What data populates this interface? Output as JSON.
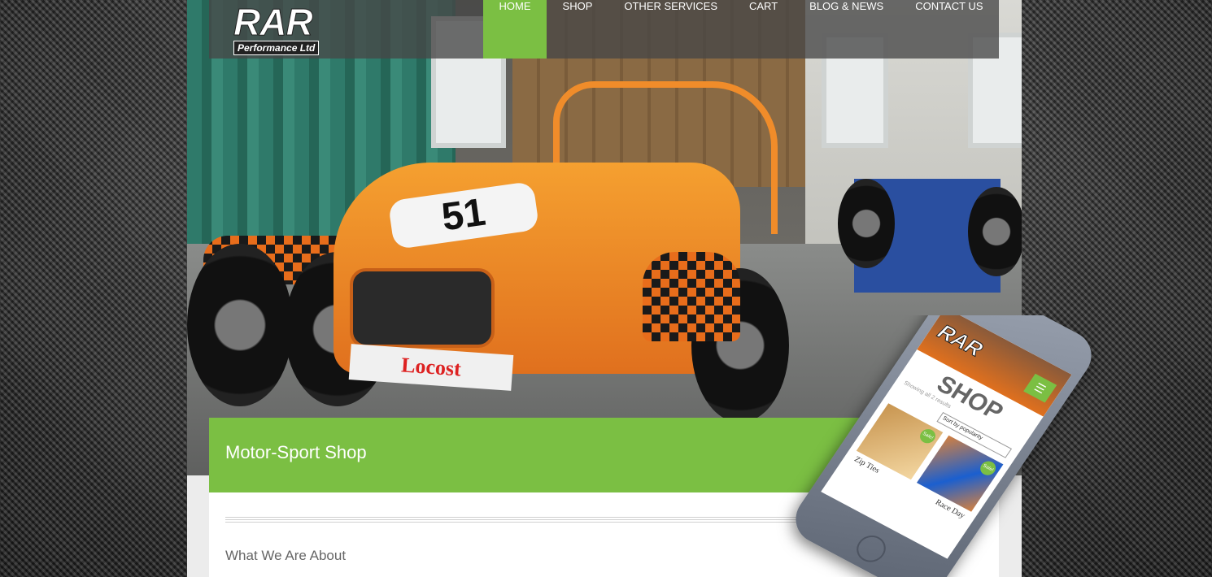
{
  "brand": {
    "logo_big": "RAR",
    "logo_small": "Performance Ltd"
  },
  "nav": {
    "items": [
      {
        "label": "HOME",
        "active": true
      },
      {
        "label": "SHOP"
      },
      {
        "label": "OTHER SERVICES"
      },
      {
        "label": "CART"
      },
      {
        "label": "BLOG & NEWS"
      },
      {
        "label": "CONTACT US"
      }
    ]
  },
  "hero": {
    "car_number": "51",
    "plate_text": "Locost"
  },
  "page": {
    "title": "Motor-Sport Shop",
    "section_heading": "What We Are About"
  },
  "mobile_preview": {
    "logo": "RAR",
    "title": "SHOP",
    "results_text": "Showing all 2 results",
    "sort_label": "Sort by popularity",
    "sale_badge": "Sale!",
    "products": [
      "Zip Ties",
      "Race Day"
    ]
  },
  "colors": {
    "accent": "#7bbf43",
    "nav_bg": "rgba(70,70,70,0.78)"
  }
}
